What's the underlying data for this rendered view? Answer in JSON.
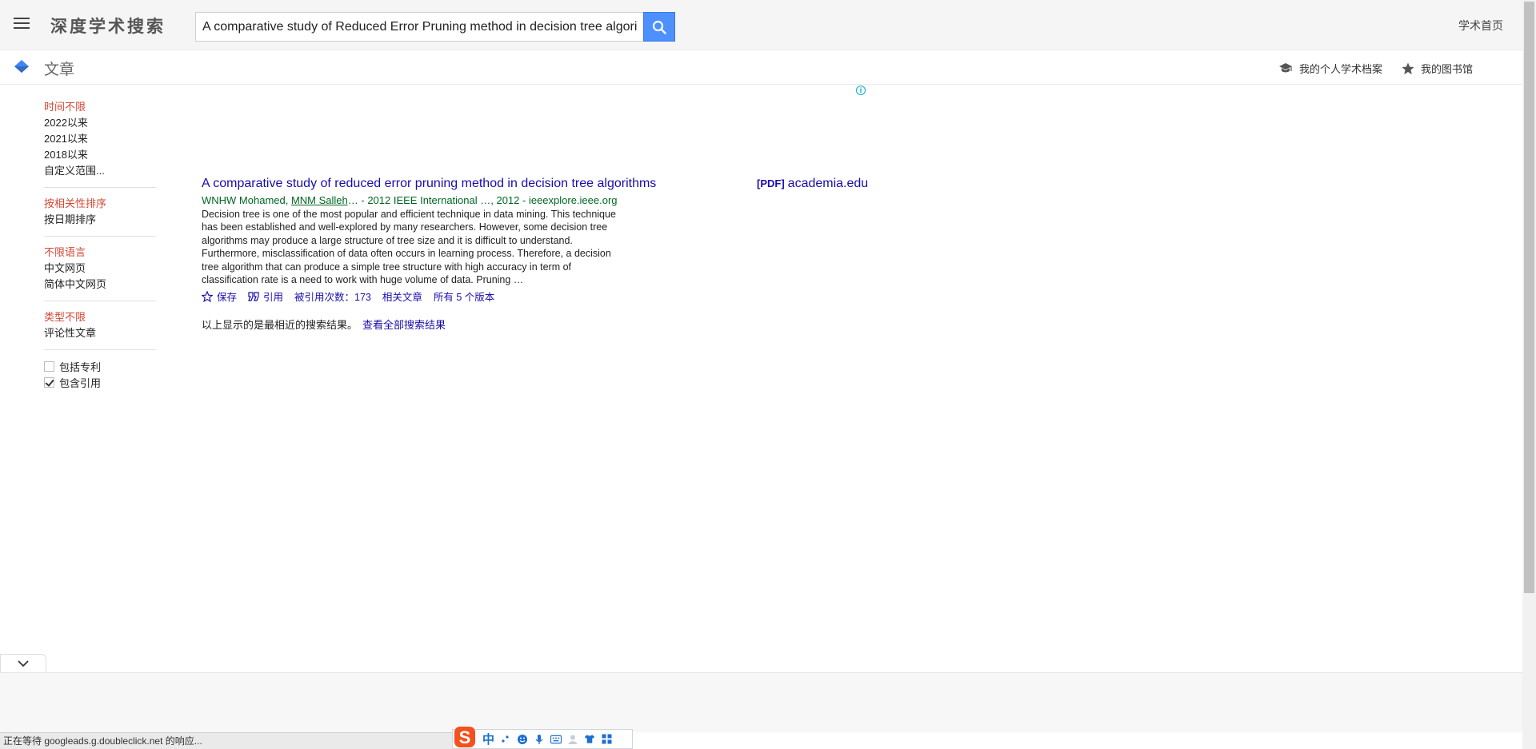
{
  "header": {
    "brand": "深度学术搜索",
    "search_value": "A comparative study of Reduced Error Pruning method in decision tree algorithms",
    "home_link": "学术首页"
  },
  "subbar": {
    "section_title": "文章",
    "profile_link": "我的个人学术档案",
    "library_link": "我的图书馆"
  },
  "sidebar": {
    "time": {
      "active": "时间不限",
      "options": [
        "2022以来",
        "2021以来",
        "2018以来",
        "自定义范围..."
      ]
    },
    "sort": {
      "active": "按相关性排序",
      "options": [
        "按日期排序"
      ]
    },
    "language": {
      "active": "不限语言",
      "options": [
        "中文网页",
        "简体中文网页"
      ]
    },
    "type": {
      "active": "类型不限",
      "options": [
        "评论性文章"
      ]
    },
    "checkboxes": [
      {
        "label": "包括专利",
        "checked": false
      },
      {
        "label": "包含引用",
        "checked": true
      }
    ]
  },
  "result": {
    "title": "A comparative study of reduced error pruning method in decision tree algorithms",
    "author1": "WNHW Mohamed, ",
    "author2": "MNM Salleh",
    "meta_rest": "… - 2012 IEEE International …, 2012 - ieeexplore.ieee.org",
    "snippet": "Decision tree is one of the most popular and efficient technique in data mining. This technique has been established and well-explored by many researchers. However, some decision tree algorithms may produce a large structure of tree size and it is difficult to understand. Furthermore, misclassification of data often occurs in learning process. Therefore, a decision tree algorithm that can produce a simple tree structure with high accuracy in term of classification rate is a need to work with huge volume of data. Pruning …",
    "actions": {
      "save": "保存",
      "cite": "引用",
      "cited_by": "被引用次数：173",
      "related": "相关文章",
      "versions": "所有 5 个版本"
    },
    "pdf_tag": "[PDF]",
    "pdf_source": "academia.edu"
  },
  "footer_note": {
    "text": "以上显示的是最相近的搜索结果。",
    "link": "查看全部搜索结果"
  },
  "status_bar": "正在等待 googleads.g.doubleclick.net 的响应...",
  "ime": {
    "mode": "中"
  },
  "colors": {
    "link": "#1a0dab",
    "active_filter": "#d14836",
    "meta_green": "#006621",
    "search_button": "#4d90fe"
  }
}
